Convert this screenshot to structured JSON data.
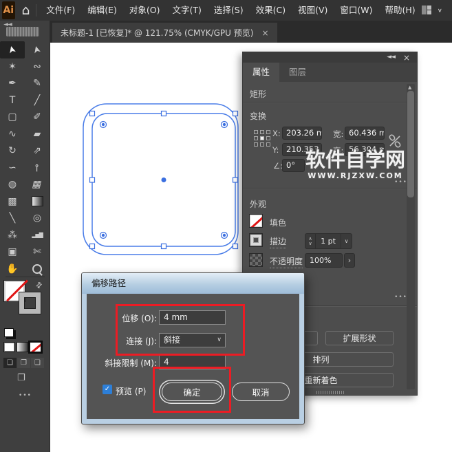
{
  "colors": {
    "ui_dark": "#333333",
    "panel": "#4d4d4d",
    "selection_blue": "#4a7de8",
    "annotation_red": "#ec1c24",
    "dialog_frame": "#b9cfe3",
    "checkbox_blue": "#2d7fd8",
    "fill_none_red": "#e01515"
  },
  "menubar": {
    "logo": "Ai",
    "home_icon": "⌂",
    "items": [
      {
        "label": "文件(F)"
      },
      {
        "label": "编辑(E)"
      },
      {
        "label": "对象(O)"
      },
      {
        "label": "文字(T)"
      },
      {
        "label": "选择(S)"
      },
      {
        "label": "效果(C)"
      },
      {
        "label": "视图(V)"
      },
      {
        "label": "窗口(W)"
      },
      {
        "label": "帮助(H)"
      }
    ],
    "workspace_chevron": "∨"
  },
  "tabbar": {
    "doc_tab": "未标题-1 [已恢复]* @ 121.75% (CMYK/GPU 预览)",
    "close": "×"
  },
  "toolbar": {
    "collapse": "◄◄",
    "more": "● ● ●",
    "tools": [
      {
        "name": "selection",
        "glyph": "➤"
      },
      {
        "name": "direct-selection",
        "glyph": "➤"
      },
      {
        "name": "magic-wand",
        "glyph": "✶"
      },
      {
        "name": "lasso",
        "glyph": "∾"
      },
      {
        "name": "pen",
        "glyph": "✒"
      },
      {
        "name": "curvature",
        "glyph": "✎"
      },
      {
        "name": "type",
        "glyph": "T"
      },
      {
        "name": "line-segment",
        "glyph": "╱"
      },
      {
        "name": "rectangle",
        "glyph": "▢"
      },
      {
        "name": "paintbrush",
        "glyph": "✐"
      },
      {
        "name": "shaper",
        "glyph": "∿"
      },
      {
        "name": "eraser",
        "glyph": "▰"
      },
      {
        "name": "rotate",
        "glyph": "↻"
      },
      {
        "name": "scale",
        "glyph": "⇗"
      },
      {
        "name": "width",
        "glyph": "∽"
      },
      {
        "name": "puppet-warp",
        "glyph": "⊸"
      },
      {
        "name": "shape-builder",
        "glyph": "◍"
      },
      {
        "name": "perspective-grid",
        "glyph": "▦"
      },
      {
        "name": "mesh",
        "glyph": "▩"
      },
      {
        "name": "gradient",
        "glyph": ""
      },
      {
        "name": "eyedropper",
        "glyph": "╲"
      },
      {
        "name": "blend",
        "glyph": "◎"
      },
      {
        "name": "symbol-sprayer",
        "glyph": "⁂"
      },
      {
        "name": "graph",
        "glyph": "▂▅▇"
      },
      {
        "name": "artboard",
        "glyph": "▣"
      },
      {
        "name": "slice",
        "glyph": "✄"
      },
      {
        "name": "hand",
        "glyph": "✋"
      },
      {
        "name": "zoom",
        "glyph": ""
      }
    ]
  },
  "panel": {
    "collapse": "◄◄",
    "close": "×",
    "more": "● ● ●",
    "tabs": [
      {
        "label": "属性"
      },
      {
        "label": "图层"
      }
    ],
    "shape_label": "矩形",
    "transform": {
      "title": "变换",
      "x_label": "X:",
      "x": "203.26 m",
      "y_label": "Y:",
      "y": "210.353",
      "w_label": "宽:",
      "w": "60.436 m",
      "h_label": "高:",
      "h": "56.304 m",
      "angle_label": "∠:",
      "angle": "0°"
    },
    "appearance": {
      "title": "外观",
      "fill_label": "填色",
      "stroke_label": "描边",
      "stroke_value": "1 pt",
      "stepper_up": "∧",
      "stepper_down": "∨",
      "stroke_chevron": "∨",
      "opacity_label": "不透明度",
      "opacity_value": "100%",
      "opacity_arrow": "›"
    },
    "quick_actions": {
      "expand_shape": "扩展形状",
      "arrange": "排列",
      "recolor": "重新着色"
    },
    "scroll_up_arrow": "▲"
  },
  "watermark": {
    "title": "软件自学网",
    "url": "WWW.RJZXW.COM"
  },
  "dialog": {
    "title": "偏移路径",
    "offset_label": "位移 (O):",
    "offset_value": "4 mm",
    "join_label": "连接 (J):",
    "join_value": "斜接",
    "join_chevron": "∨",
    "miter_label": "斜接限制 (M):",
    "miter_value": "4",
    "preview_check": "✓",
    "preview_label": "预览 (P)",
    "ok": "确定",
    "cancel": "取消"
  }
}
